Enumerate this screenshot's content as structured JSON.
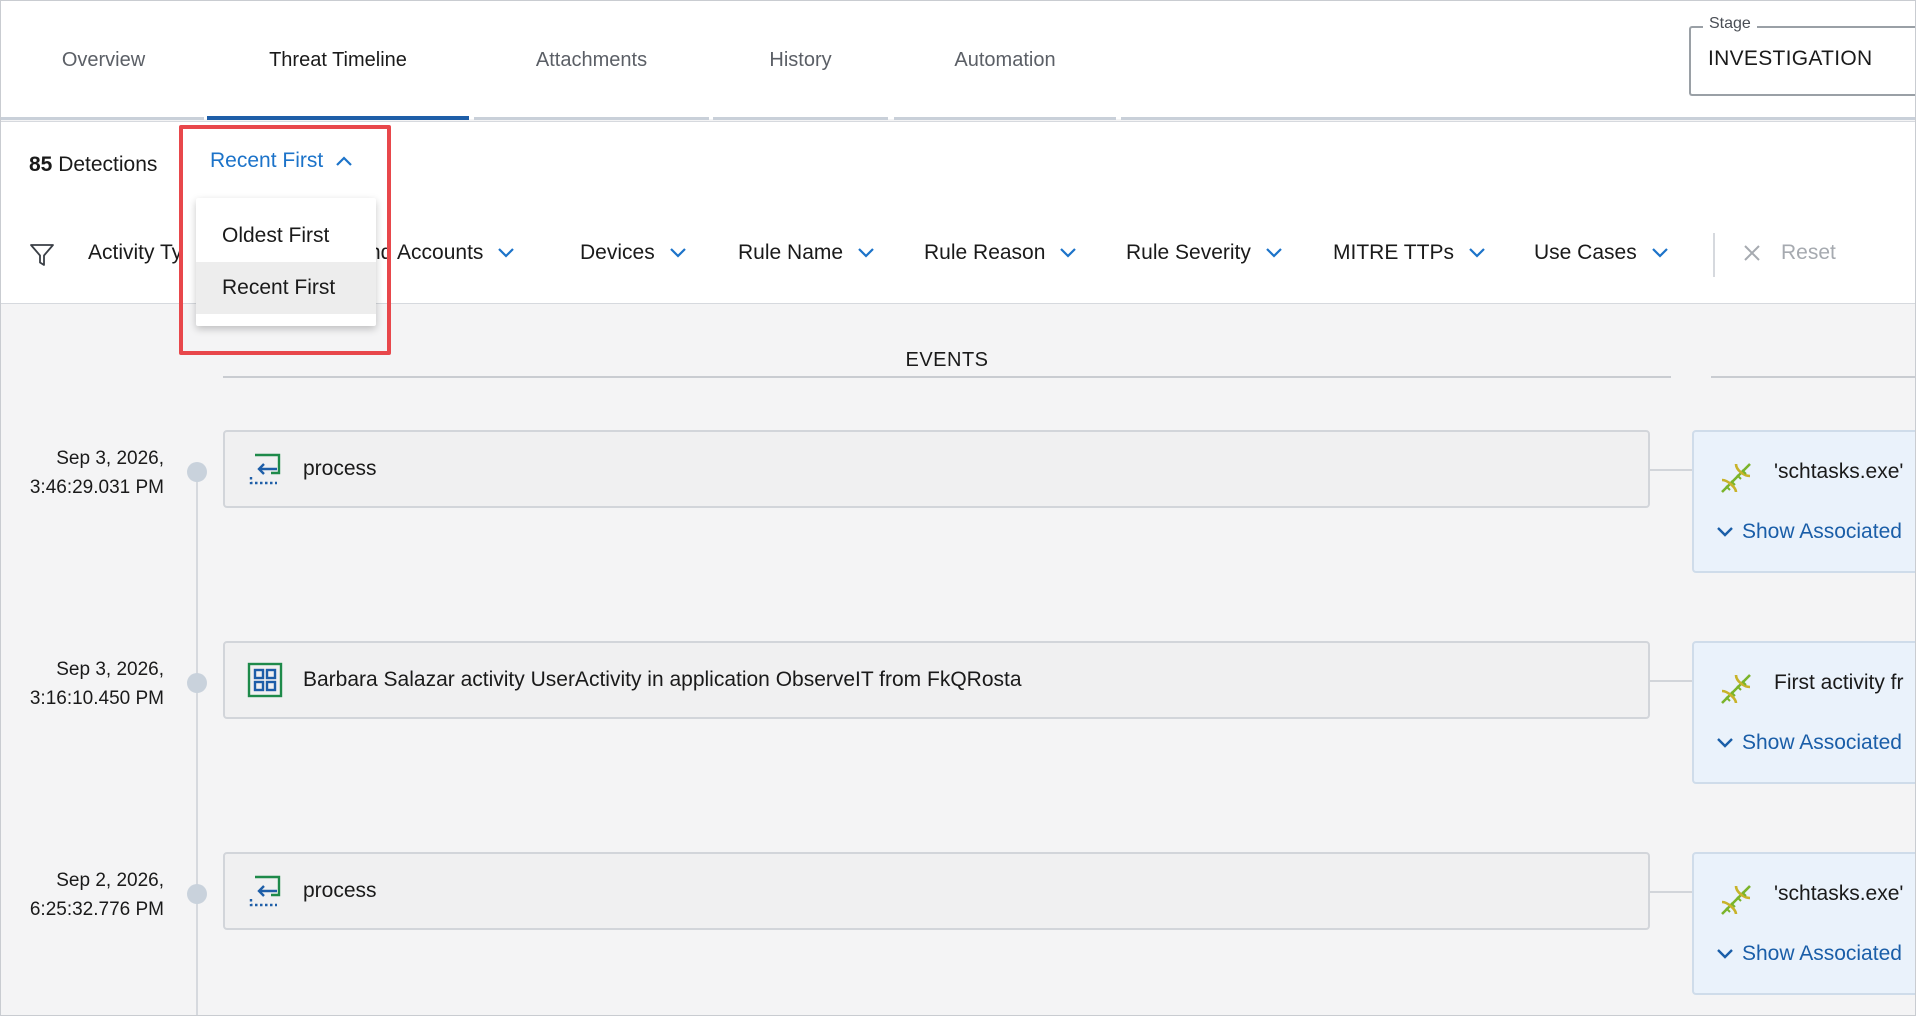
{
  "tabs": [
    {
      "label": "Overview"
    },
    {
      "label": "Threat Timeline"
    },
    {
      "label": "Attachments"
    },
    {
      "label": "History"
    },
    {
      "label": "Automation"
    }
  ],
  "active_tab": "Threat Timeline",
  "stage": {
    "label": "Stage",
    "value": "INVESTIGATION"
  },
  "detections": {
    "count": "85",
    "label": "Detections"
  },
  "sort": {
    "current": "Recent First",
    "options": [
      "Oldest First",
      "Recent First"
    ],
    "selected_index": 1
  },
  "filters": {
    "items": [
      "Activity Ty",
      "nd Accounts",
      "Devices",
      "Rule Name",
      "Rule Reason",
      "Rule Severity",
      "MITRE TTPs",
      "Use Cases"
    ],
    "reset_label": "Reset"
  },
  "events_header": "EVENTS",
  "timeline": [
    {
      "date": "Sep 3, 2026,",
      "time": "3:46:29.031 PM",
      "event_icon": "process-icon",
      "event_text": "process",
      "detection_text": "'schtasks.exe'",
      "show_label": "Show Associated"
    },
    {
      "date": "Sep 3, 2026,",
      "time": "3:16:10.450 PM",
      "event_icon": "app-activity-icon",
      "event_text": "Barbara Salazar activity UserActivity in application ObserveIT from FkQRosta",
      "detection_text": "First activity fr",
      "show_label": "Show Associated"
    },
    {
      "date": "Sep 2, 2026,",
      "time": "6:25:32.776 PM",
      "event_icon": "process-icon",
      "event_text": "process",
      "detection_text": "'schtasks.exe'",
      "show_label": "Show Associated"
    }
  ],
  "colors": {
    "accent": "#1c73c9",
    "highlight_border": "#e8474b",
    "detection_bg": "#eaf2fb"
  }
}
